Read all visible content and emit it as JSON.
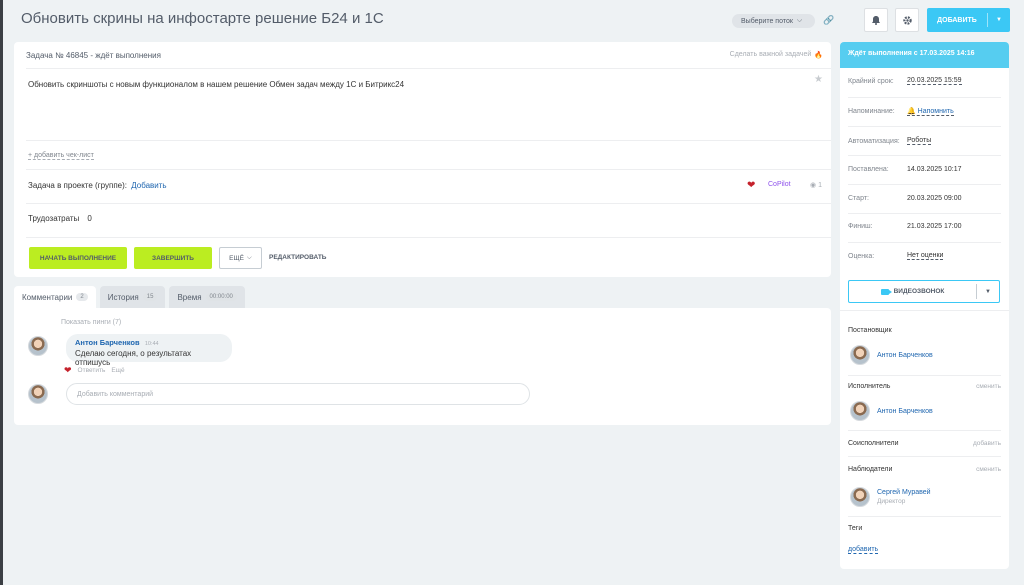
{
  "header": {
    "title": "Обновить скрины на инфостарте решение Б24 и 1С",
    "flow_label": "Выберите поток",
    "add_label": "ДОБАВИТЬ"
  },
  "task": {
    "heading": "Задача № 46845 - ждёт выполнения",
    "mark_important": "Сделать важной задачей",
    "description": "Обновить скриншоты с новым функционалом в нашем решение Обмен задач между 1С и Битрикс24",
    "add_checklist": "+ добавить чек-лист",
    "project_label": "Задача в проекте (группе):",
    "project_add": "Добавить",
    "copilot": "CoPilot",
    "views": "1",
    "time_label": "Трудозатраты",
    "time_value": "0",
    "buttons": {
      "start": "НАЧАТЬ ВЫПОЛНЕНИЕ",
      "finish": "ЗАВЕРШИТЬ",
      "more": "ЕЩЁ",
      "edit": "РЕДАКТИРОВАТЬ"
    }
  },
  "tabs": [
    {
      "label": "Комментарии",
      "count": "2"
    },
    {
      "label": "История",
      "count": "15"
    },
    {
      "label": "Время",
      "count": "00:00:00"
    }
  ],
  "comments": {
    "show_pings": "Показать пинги (7)",
    "items": [
      {
        "author": "Антон Барченков",
        "time": "10:44",
        "text": "Сделаю сегодня, о результатах отпишусь"
      }
    ],
    "reply": "Ответить",
    "more": "Ещё",
    "placeholder": "Добавить комментарий"
  },
  "sidebar": {
    "status": "Ждёт выполнения с 17.03.2025 14:16",
    "fields": [
      {
        "label": "Крайний срок:",
        "value": "20.03.2025 15:59"
      },
      {
        "label": "Напоминание:",
        "value": "Напомнить"
      },
      {
        "label": "Автоматизация:",
        "value": "Роботы"
      },
      {
        "label": "Поставлена:",
        "value": "14.03.2025 10:17"
      },
      {
        "label": "Старт:",
        "value": "20.03.2025 09:00"
      },
      {
        "label": "Финиш:",
        "value": "21.03.2025 17:00"
      },
      {
        "label": "Оценка:",
        "value": "Нет оценки"
      }
    ],
    "video_call": "ВИДЕОЗВОНОК",
    "creator_label": "Постановщик",
    "creator": "Антон Барченков",
    "assignee_label": "Исполнитель",
    "assignee_action": "сменить",
    "assignee": "Антон Барченков",
    "coexec_label": "Соисполнители",
    "coexec_action": "добавить",
    "observers_label": "Наблюдатели",
    "observers_action": "сменить",
    "observer": "Сергей Муравей",
    "observer_role": "Директор",
    "tags_label": "Теги",
    "tags_add": "добавить"
  }
}
